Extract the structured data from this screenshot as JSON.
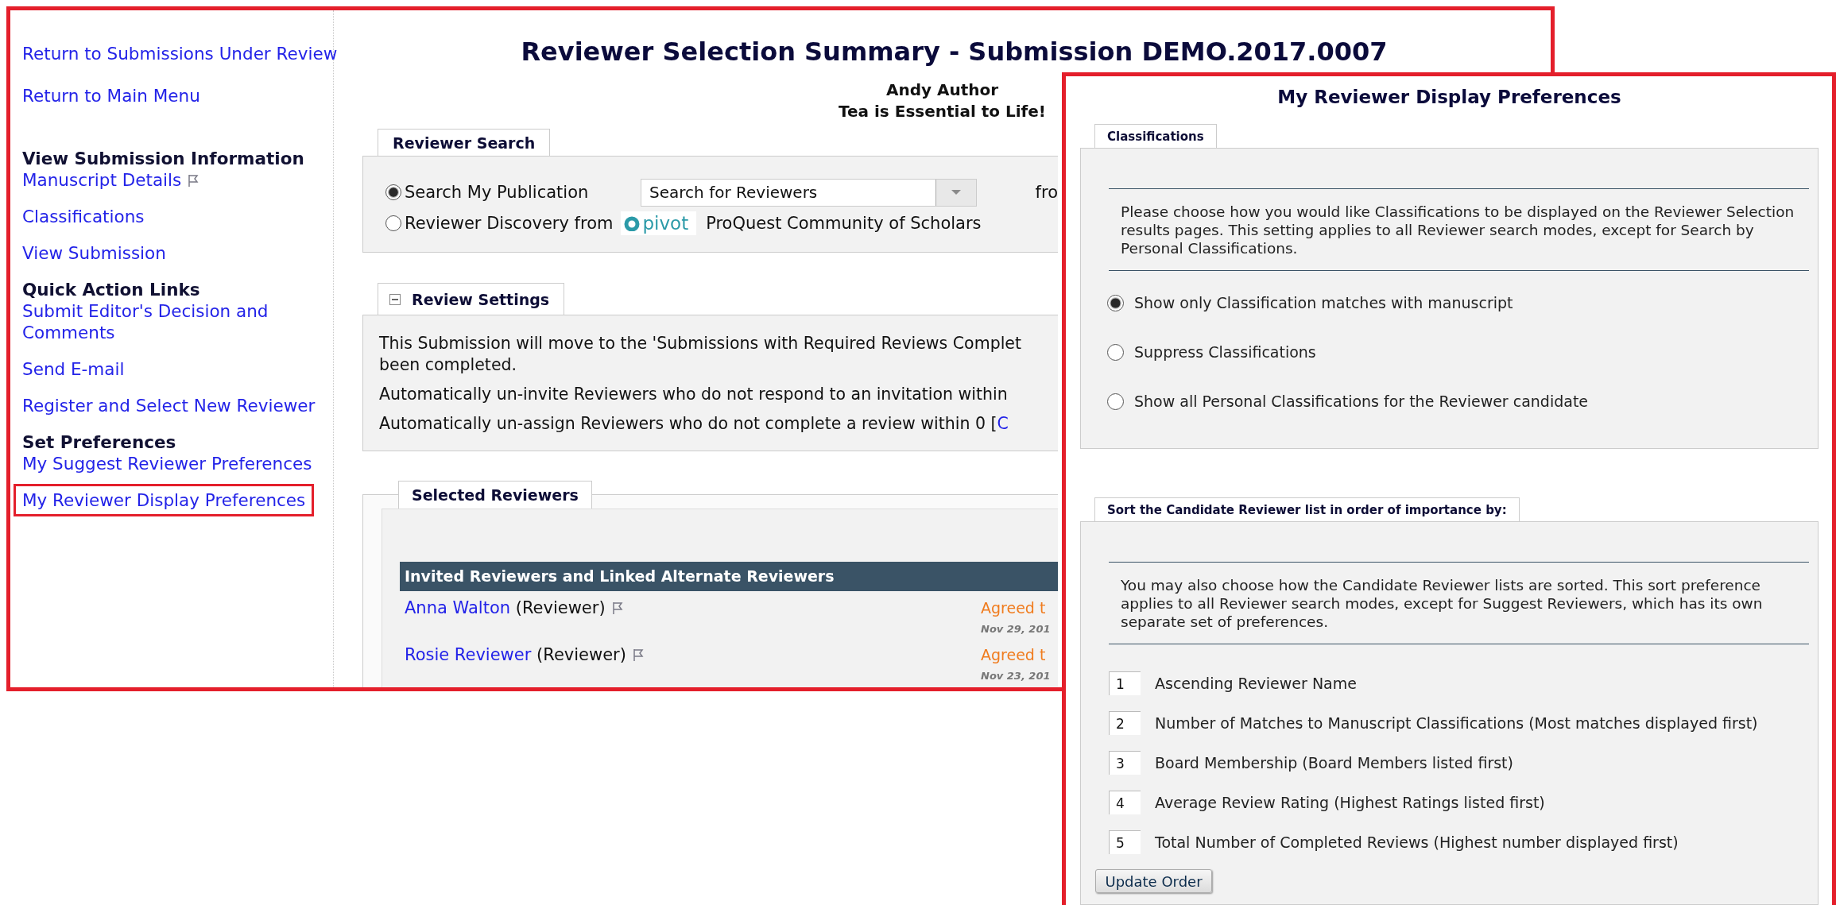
{
  "sidebar": {
    "top_links": [
      {
        "label": "Return to Submissions Under Review"
      },
      {
        "label": "Return to Main Menu"
      }
    ],
    "sections": [
      {
        "heading": "View Submission Information",
        "items": [
          {
            "label": "Manuscript Details",
            "flagged": true,
            "highlighted": false
          },
          {
            "label": "Classifications",
            "flagged": false,
            "highlighted": false
          },
          {
            "label": "View Submission",
            "flagged": false,
            "highlighted": false
          }
        ]
      },
      {
        "heading": "Quick Action Links",
        "items": [
          {
            "label": "Submit Editor's Decision and Comments",
            "flagged": false,
            "highlighted": false
          },
          {
            "label": "Send E-mail",
            "flagged": false,
            "highlighted": false
          },
          {
            "label": "Register and Select New Reviewer",
            "flagged": false,
            "highlighted": false
          }
        ]
      },
      {
        "heading": "Set Preferences",
        "items": [
          {
            "label": "My Suggest Reviewer Preferences",
            "flagged": false,
            "highlighted": false
          },
          {
            "label": "My Reviewer Display Preferences",
            "flagged": false,
            "highlighted": true
          }
        ]
      }
    ]
  },
  "header": {
    "title": "Reviewer Selection Summary - Submission DEMO.2017.0007",
    "author": "Andy Author",
    "manuscript_title": "Tea is Essential to Life!"
  },
  "reviewer_search": {
    "legend": "Reviewer Search",
    "options": [
      {
        "label": "Search My Publication",
        "selected": true
      },
      {
        "label": "Reviewer Discovery from",
        "logo": "pivot",
        "note": "ProQuest Community of Scholars",
        "selected": false
      }
    ],
    "dropdown": {
      "value": "Search for Reviewers"
    },
    "trailing_text": "fro"
  },
  "review_settings": {
    "legend": "Review Settings",
    "expanded": true,
    "paragraphs": [
      {
        "lines": [
          "This Submission will move to the 'Submissions with Required Reviews Complet",
          "been completed."
        ]
      },
      {
        "lines": [
          "Automatically un-invite Reviewers who do not respond to an invitation within"
        ]
      },
      {
        "lines": [
          "Automatically un-assign Reviewers who do not complete a review within 0 ["
        ],
        "link": "C"
      }
    ]
  },
  "selected_reviewers": {
    "legend": "Selected Reviewers",
    "table": {
      "header": "Invited Reviewers and Linked Alternate Reviewers",
      "rows": [
        {
          "name": "Anna Walton",
          "role": "(Reviewer)",
          "flagged": true,
          "status": "Agreed t",
          "date": "Nov 29, 201"
        },
        {
          "name": "Rosie Reviewer",
          "role": "(Reviewer)",
          "flagged": true,
          "status": "Agreed t",
          "date": "Nov 23, 201"
        }
      ]
    }
  },
  "preferences_window": {
    "title": "My Reviewer Display Preferences",
    "classifications": {
      "legend": "Classifications",
      "description": "Please choose how you would like Classifications to be displayed on the Reviewer Selection results pages. This setting applies to all Reviewer search modes, except for Search by Personal Classifications.",
      "options": [
        {
          "label": "Show only Classification matches with manuscript",
          "selected": true
        },
        {
          "label": "Suppress Classifications",
          "selected": false
        },
        {
          "label": "Show all Personal Classifications for the Reviewer candidate",
          "selected": false
        }
      ]
    },
    "sort": {
      "legend": "Sort the Candidate Reviewer list in order of importance by:",
      "description": "You may also choose how the Candidate Reviewer lists are sorted. This sort preference applies to all Reviewer search modes, except for Suggest Reviewers, which has its own separate set of preferences.",
      "criteria": [
        {
          "rank": "1",
          "label": "Ascending Reviewer Name"
        },
        {
          "rank": "2",
          "label": "Number of Matches to Manuscript Classifications (Most matches displayed first)"
        },
        {
          "rank": "3",
          "label": "Board Membership (Board Members listed first)"
        },
        {
          "rank": "4",
          "label": "Average Review Rating (Highest Ratings listed first)"
        },
        {
          "rank": "5",
          "label": "Total Number of Completed Reviews (Highest number displayed first)"
        }
      ],
      "button": "Update Order"
    }
  }
}
